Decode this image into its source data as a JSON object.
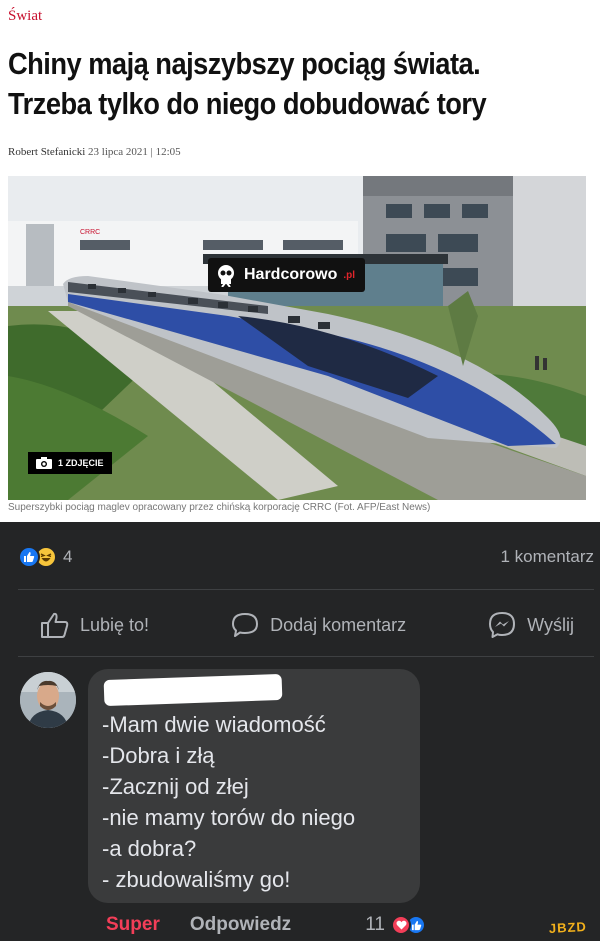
{
  "article": {
    "section": "Świat",
    "headline_line1": "Chiny mają najszybszy pociąg świata.",
    "headline_line2": "Trzeba tylko do niego dobudować tory",
    "author": "Robert Stefanicki",
    "date": "23 lipca 2021 | 12:05",
    "photo_count": "1 ZDJĘCIE",
    "watermark": "Hardcorowo",
    "watermark_suffix": ".pl",
    "building_sign": "CRRC",
    "caption": "Superszybki pociąg maglev opracowany przez chińską korporację CRRC (Fot. AFP/East News)"
  },
  "post": {
    "reaction_count": "4",
    "comments_count": "1 komentarz",
    "actions": {
      "like": "Lubię to!",
      "comment": "Dodaj komentarz",
      "share": "Wyślij"
    },
    "reaction_icons": [
      "like-icon",
      "haha-icon"
    ]
  },
  "comment": {
    "lines": [
      "-Mam dwie wiadomość",
      "-Dobra i złą",
      "-Zacznij od złej",
      "-nie mamy torów do niego",
      "-a dobra?",
      "- zbudowaliśmy go!"
    ],
    "reaction_label": "Super",
    "reply_label": "Odpowiedz",
    "reaction_count": "11",
    "reaction_icons": [
      "love-icon",
      "like-icon"
    ]
  },
  "site_badge": "JBZD",
  "colors": {
    "section_red": "#c8102e",
    "fb_bg": "#242526",
    "bubble_bg": "#3a3b3c",
    "like_blue": "#1877f2",
    "love_red": "#f33e58",
    "haha_yellow": "#f7c53b"
  }
}
